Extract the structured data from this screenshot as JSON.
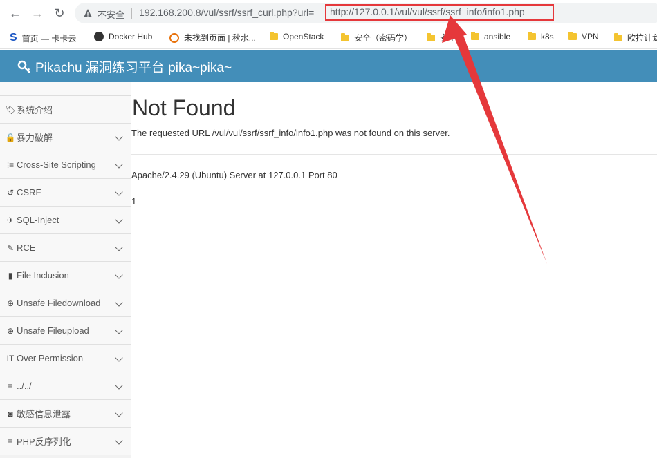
{
  "browser": {
    "insecure_label": "不安全",
    "url_prefix": "192.168.200.8/vul/ssrf/ssrf_curl.php?url=",
    "url_param": "http://127.0.0.1/vul/vul/ssrf/ssrf_info/info1.php"
  },
  "bookmarks": [
    {
      "label": "首页 — 卡卡云",
      "icon": "s-logo"
    },
    {
      "label": "Docker Hub",
      "icon": "docker-icon"
    },
    {
      "label": "未找到页面 | 秋水...",
      "icon": "ring-icon"
    },
    {
      "label": "OpenStack",
      "icon": "folder-icon"
    },
    {
      "label": "安全（密码学）",
      "icon": "folder-icon"
    },
    {
      "label": "安全",
      "icon": "folder-icon"
    },
    {
      "label": "ansible",
      "icon": "folder-icon"
    },
    {
      "label": "k8s",
      "icon": "folder-icon"
    },
    {
      "label": "VPN",
      "icon": "folder-icon"
    },
    {
      "label": "欧拉计划",
      "icon": "folder-icon"
    }
  ],
  "header": {
    "title": "Pikachu 漏洞练习平台 pika~pika~"
  },
  "sidebar": {
    "items": [
      {
        "label": "系统介绍",
        "icon": "tags-icon",
        "glyph": "🏷"
      },
      {
        "label": "暴力破解",
        "icon": "lock-icon",
        "glyph": "🔒"
      },
      {
        "label": "Cross-Site Scripting",
        "icon": "list-icon",
        "glyph": "⁞≡"
      },
      {
        "label": "CSRF",
        "icon": "share-icon",
        "glyph": "↺"
      },
      {
        "label": "SQL-Inject",
        "icon": "plane-icon",
        "glyph": "✈"
      },
      {
        "label": "RCE",
        "icon": "pencil-icon",
        "glyph": "✎"
      },
      {
        "label": "File Inclusion",
        "icon": "file-icon",
        "glyph": "▮"
      },
      {
        "label": "Unsafe Filedownload",
        "icon": "download-icon",
        "glyph": "⊕"
      },
      {
        "label": "Unsafe Fileupload",
        "icon": "upload-icon",
        "glyph": "⊕"
      },
      {
        "label": "Over Permission",
        "icon": "text-height-icon",
        "glyph": "IT"
      },
      {
        "label": "../../",
        "icon": "align-icon",
        "glyph": "≡"
      },
      {
        "label": "敏感信息泄露",
        "icon": "camera-icon",
        "glyph": "◙"
      },
      {
        "label": "PHP反序列化",
        "icon": "align-icon",
        "glyph": "≡"
      }
    ]
  },
  "main": {
    "title": "Not Found",
    "message": "The requested URL /vul/vul/ssrf/ssrf_info/info1.php was not found on this server.",
    "server": "Apache/2.4.29 (Ubuntu) Server at 127.0.0.1 Port 80",
    "output": "1"
  },
  "colors": {
    "header_bg": "#438eb9",
    "annotation_red": "#e5383b"
  }
}
